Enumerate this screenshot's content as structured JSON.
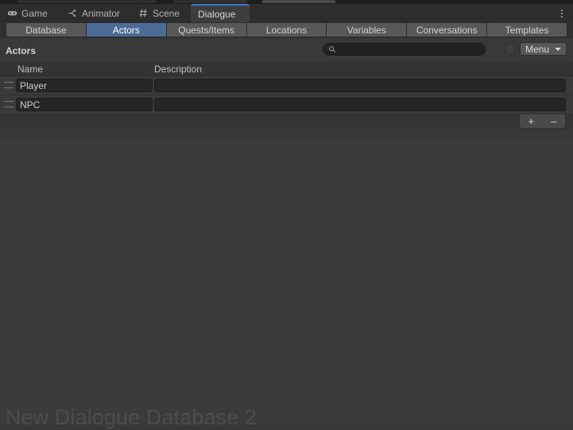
{
  "window_tabs": [
    {
      "label": "Game",
      "icon": "gamepad-icon",
      "active": false
    },
    {
      "label": "Animator",
      "icon": "animator-branch-icon",
      "active": false
    },
    {
      "label": "Scene",
      "icon": "grid-hash-icon",
      "active": false
    },
    {
      "label": "Dialogue",
      "icon": "none",
      "active": true
    }
  ],
  "window_menu_icon": "kebab-menu-icon",
  "sub_tabs": [
    {
      "label": "Database",
      "selected": false
    },
    {
      "label": "Actors",
      "selected": true
    },
    {
      "label": "Quests/Items",
      "selected": false
    },
    {
      "label": "Locations",
      "selected": false
    },
    {
      "label": "Variables",
      "selected": false
    },
    {
      "label": "Conversations",
      "selected": false
    },
    {
      "label": "Templates",
      "selected": false
    }
  ],
  "section": {
    "title": "Actors",
    "search": {
      "value": "",
      "placeholder": "",
      "icon": "search-icon"
    },
    "clear_icon": "clear-circle-icon",
    "menu_button": {
      "label": "Menu",
      "caret": "chevron-down-icon"
    }
  },
  "table": {
    "columns": [
      "Name",
      "Description"
    ],
    "rows": [
      {
        "name": "Player",
        "description": ""
      },
      {
        "name": "NPC",
        "description": ""
      }
    ]
  },
  "list_footer": {
    "add_label": "+",
    "remove_label": "–"
  },
  "watermark": "New Dialogue Database 2",
  "colors": {
    "accent_blue": "#4b6b96",
    "active_tab_border": "#3d7bd4",
    "panel_bg": "#3b3b3b",
    "tab_bg": "#585858",
    "field_bg": "#262626"
  }
}
